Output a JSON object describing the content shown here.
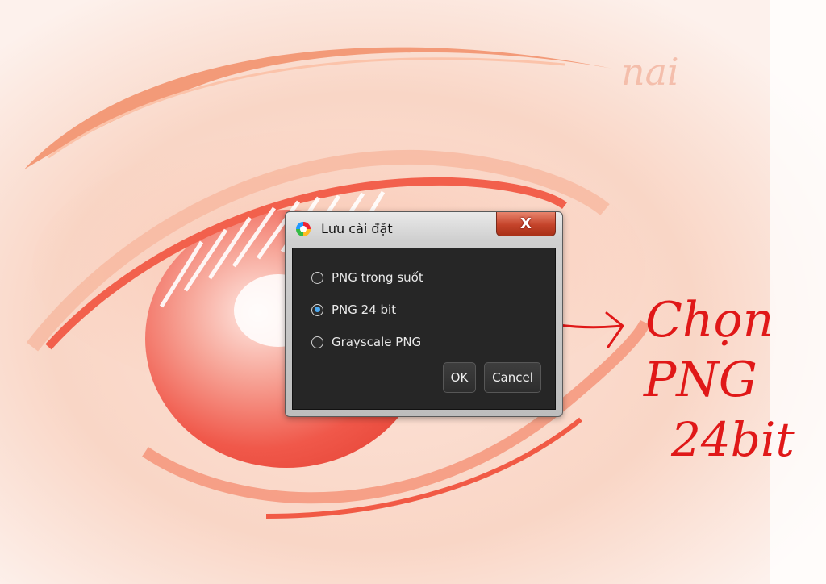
{
  "dialog": {
    "title": "Lưu cài đặt",
    "close_label": "X",
    "options": [
      {
        "label": "PNG trong suốt",
        "checked": false
      },
      {
        "label": "PNG 24 bit",
        "checked": true
      },
      {
        "label": "Grayscale PNG",
        "checked": false
      }
    ],
    "ok_label": "OK",
    "cancel_label": "Cancel"
  },
  "annotation": {
    "text_lines": [
      "Chọn",
      "PNG",
      "24bit"
    ],
    "color": "#e01818"
  },
  "artwork": {
    "signature": "nai"
  },
  "colors": {
    "accent_radio": "#4aa8f0",
    "dialog_body": "#262626"
  }
}
